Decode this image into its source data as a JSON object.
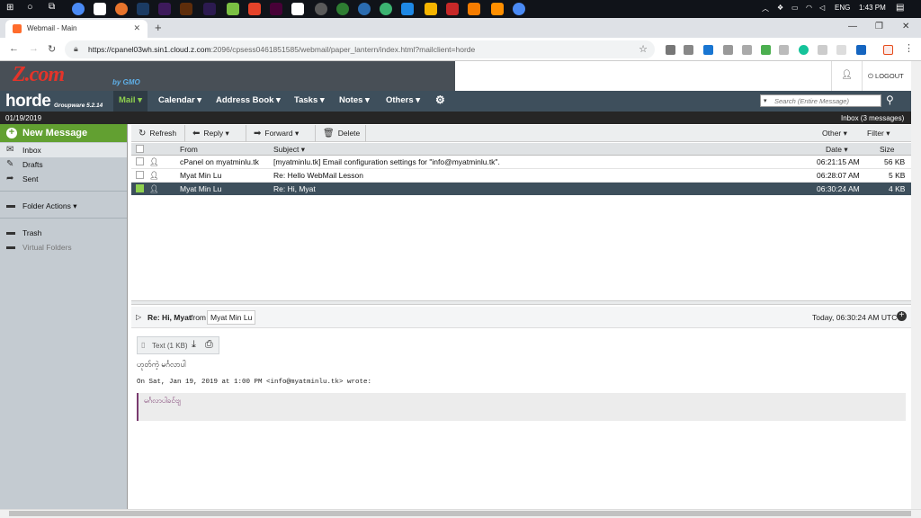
{
  "taskbar": {
    "lang": "ENG",
    "time": "1:43 PM"
  },
  "browser": {
    "tab_title": "Webmail - Main",
    "url_host": "https://cpanel03wh.sin1.cloud.z.com",
    "url_path": ":2096/cpsess0461851585/webmail/paper_lantern/index.html?mailclient=horde",
    "newtab": "+"
  },
  "brand": {
    "logo": "Z.com",
    "logo_sub": "by GMO",
    "logout": "LOGOUT"
  },
  "menubar": {
    "logo": "horde",
    "version": "Groupware 5.2.14",
    "items": [
      "Mail",
      "Calendar",
      "Address Book",
      "Tasks",
      "Notes",
      "Others"
    ],
    "search_placeholder": "Search (Entire Message)"
  },
  "status": {
    "date": "01/19/2019",
    "inbox_count": "Inbox (3 messages)"
  },
  "sidebar": {
    "new_message": "New Message",
    "folders": [
      "Inbox",
      "Drafts",
      "Sent"
    ],
    "folder_actions": "Folder Actions",
    "trash": "Trash",
    "virtual_folders": "Virtual Folders"
  },
  "toolbar": {
    "refresh": "Refresh",
    "reply": "Reply",
    "forward": "Forward",
    "delete": "Delete",
    "other": "Other",
    "filter": "Filter"
  },
  "list": {
    "headers": {
      "from": "From",
      "subject": "Subject",
      "date": "Date",
      "size": "Size"
    },
    "rows": [
      {
        "from": "cPanel on myatminlu.tk",
        "subject": "[myatminlu.tk] Email configuration settings for \"info@myatminlu.tk\".",
        "date": "06:21:15 AM",
        "size": "56 KB"
      },
      {
        "from": "Myat Min Lu",
        "subject": "Re: Hello WebMail Lesson",
        "date": "06:28:07 AM",
        "size": "5 KB"
      },
      {
        "from": "Myat Min Lu",
        "subject": "Re: Hi, Myat",
        "date": "06:30:24 AM",
        "size": "4 KB"
      }
    ]
  },
  "preview": {
    "subject": "Re: Hi, Myat",
    "from_label": "from",
    "from_name": "Myat Min Lu",
    "date": "Today, 06:30:24 AM UTC",
    "attachment": "Text (1 KB)",
    "body": "ဟုတ်ကဲ့ မင်္ဂလာပါ",
    "quote_header": "On Sat, Jan 19, 2019 at 1:00 PM <info@myatminlu.tk> wrote:",
    "quote_body": "မင်္ဂလာပါခင်ဗျ"
  },
  "colors": {
    "menubar": "#3e4f5c",
    "new_message": "#62a031",
    "selected_row": "#3d4f5c",
    "accent_green": "#8fd14f"
  }
}
